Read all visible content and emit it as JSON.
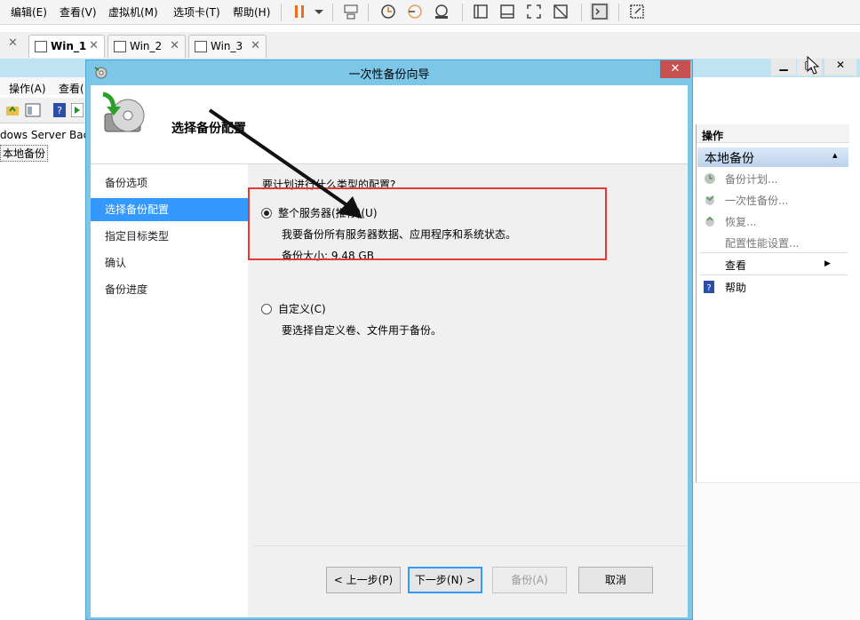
{
  "vmware_menu": {
    "items": [
      "编辑(E)",
      "查看(V)",
      "虚拟机(M)",
      "选项卡(T)",
      "帮助(H)"
    ]
  },
  "tabs": [
    {
      "label": "Win_1",
      "active": true
    },
    {
      "label": "Win_2",
      "active": false
    },
    {
      "label": "Win_3",
      "active": false
    }
  ],
  "guest": {
    "menu": [
      "操作(A)",
      "查看("
    ],
    "tree_label": "dows Server Back",
    "tree_selected": "本地备份"
  },
  "actions_pane": {
    "header": "操作",
    "group": "本地备份",
    "items": [
      {
        "label": "备份计划...",
        "disabled": true,
        "icon": "backup-schedule-icon"
      },
      {
        "label": "一次性备份...",
        "disabled": true,
        "icon": "backup-once-icon"
      },
      {
        "label": "恢复...",
        "disabled": true,
        "icon": "recover-icon"
      },
      {
        "label": "配置性能设置...",
        "disabled": true,
        "icon": ""
      },
      {
        "label": "查看",
        "disabled": false,
        "icon": ""
      },
      {
        "label": "帮助",
        "disabled": false,
        "icon": "help-icon"
      }
    ]
  },
  "wizard": {
    "title": "一次性备份向导",
    "heading": "选择备份配置",
    "nav": [
      "备份选项",
      "选择备份配置",
      "指定目标类型",
      "确认",
      "备份进度"
    ],
    "active_nav": 1,
    "question": "要计划进行什么类型的配置?",
    "option_full": {
      "label": "整个服务器(推荐)(U)",
      "desc": "我要备份所有服务器数据、应用程序和系统状态。",
      "size": "备份大小: 9.48 GB",
      "checked": true
    },
    "option_custom": {
      "label": "自定义(C)",
      "desc": "要选择自定义卷、文件用于备份。",
      "checked": false
    },
    "buttons": {
      "prev": "< 上一步(P)",
      "next": "下一步(N) >",
      "backup": "备份(A)",
      "cancel": "取消"
    }
  },
  "colors": {
    "dialog_frame": "#7cc6e8",
    "nav_selected": "#3399ff",
    "highlight": "#e53935",
    "close_button": "#c75050"
  }
}
